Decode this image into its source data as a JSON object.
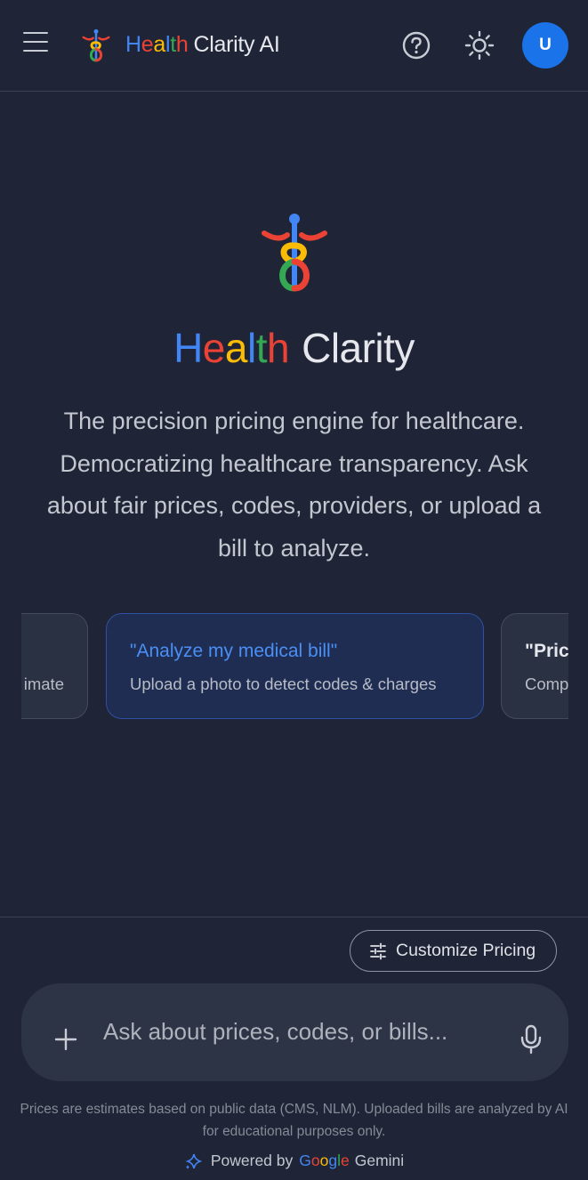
{
  "header": {
    "title_part1": [
      "H",
      "e",
      "a",
      "l",
      "t",
      "h"
    ],
    "title_part2": "Clarity AI",
    "avatar_initial": "U"
  },
  "hero": {
    "title_part1": [
      "H",
      "e",
      "a",
      "l",
      "t",
      "h"
    ],
    "title_part2": "Clarity",
    "description": "The precision pricing engine for healthcare. Democratizing healthcare transparency. Ask about fair prices, codes, providers, or upload a bill to analyze."
  },
  "suggestions": [
    {
      "title": "",
      "subtitle": "imate"
    },
    {
      "title": "\"Analyze my medical bill\"",
      "subtitle": "Upload a photo to detect codes & charges"
    },
    {
      "title": "\"Pric",
      "subtitle": "Comp"
    }
  ],
  "customize_button": {
    "label": "Customize Pricing"
  },
  "chat": {
    "placeholder": "Ask about prices, codes, or bills..."
  },
  "footer": {
    "disclaimer": "Prices are estimates based on public data (CMS, NLM). Uploaded bills are analyzed by AI for educational purposes only.",
    "powered_by": "Powered by",
    "google": [
      "G",
      "o",
      "o",
      "g",
      "l",
      "e"
    ],
    "gemini": "Gemini"
  },
  "colors": {
    "background": "#1f2536",
    "accent_blue": "#4285f4",
    "accent_red": "#ea4335",
    "accent_yellow": "#fbbc05",
    "accent_green": "#34a853",
    "avatar": "#1a73e8"
  },
  "icons": [
    "menu-icon",
    "caduceus-logo-icon",
    "help-icon",
    "sun-icon",
    "tune-icon",
    "plus-icon",
    "mic-icon",
    "sparkle-icon"
  ]
}
